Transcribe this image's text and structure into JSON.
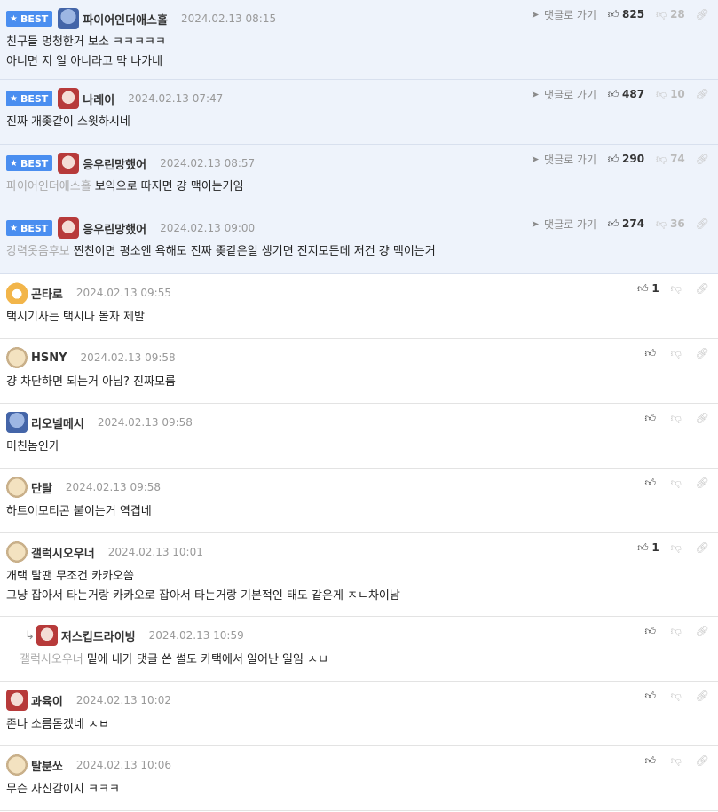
{
  "labels": {
    "best": "BEST",
    "reply_to": "댓글로 가기"
  },
  "colors": {
    "best_bg": "#eef3fb",
    "badge": "#4a8ef0"
  },
  "comments": [
    {
      "best": true,
      "avatar": "blue-character",
      "nick": "파이어인더애스홀",
      "time": "2024.02.13 08:15",
      "mention": "",
      "lines": [
        "친구들 멍청한거 보소 ㅋㅋㅋㅋㅋ",
        "아니면 지 일 아니라고 막 나가네"
      ],
      "up": "825",
      "down": "28"
    },
    {
      "best": true,
      "avatar": "dog-face",
      "nick": "나레이",
      "time": "2024.02.13 07:47",
      "mention": "",
      "lines": [
        "진짜 개좆같이 스윗하시네"
      ],
      "up": "487",
      "down": "10"
    },
    {
      "best": true,
      "avatar": "dog-face",
      "nick": "응우린망했어",
      "time": "2024.02.13 08:57",
      "mention": "파이어인더애스홀",
      "lines": [
        "보익으로 따지면 걍 맥이는거임"
      ],
      "up": "290",
      "down": "74"
    },
    {
      "best": true,
      "avatar": "dog-face",
      "nick": "응우린망했어",
      "time": "2024.02.13 09:00",
      "mention": "강력옷음후보",
      "lines": [
        "찐친이면 평소엔 욕해도 진짜 좆같은일 생기면 진지모든데 저건 걍 맥이는거"
      ],
      "up": "274",
      "down": "36"
    },
    {
      "best": false,
      "avatar": "corgi",
      "nick": "곤타로",
      "time": "2024.02.13 09:55",
      "mention": "",
      "lines": [
        "택시기사는 택시나 몰자 제발"
      ],
      "up": "1",
      "down": ""
    },
    {
      "best": false,
      "avatar": "puppy",
      "nick": "HSNY",
      "time": "2024.02.13 09:58",
      "mention": "",
      "lines": [
        "걍 차단하면 되는거 아님? 진짜모름"
      ],
      "up": "",
      "down": ""
    },
    {
      "best": false,
      "avatar": "blue-character",
      "nick": "리오넬메시",
      "time": "2024.02.13 09:58",
      "mention": "",
      "lines": [
        "미친놈인가"
      ],
      "up": "",
      "down": ""
    },
    {
      "best": false,
      "avatar": "puppy",
      "nick": "단탈",
      "time": "2024.02.13 09:58",
      "mention": "",
      "lines": [
        "하트이모티콘 붙이는거 역겹네"
      ],
      "up": "",
      "down": ""
    },
    {
      "best": false,
      "avatar": "puppy",
      "nick": "갤럭시오우너",
      "time": "2024.02.13 10:01",
      "mention": "",
      "lines": [
        "개택 탈땐 무조건 카카오씀",
        "그냥 잡아서 타는거랑 카카오로 잡아서 타는거랑 기본적인 태도 같은게 ㅈㄴ차이남"
      ],
      "up": "1",
      "down": ""
    },
    {
      "best": false,
      "reply": true,
      "avatar": "dog-face",
      "nick": "저스킵드라이빙",
      "time": "2024.02.13 10:59",
      "mention": "갤럭시오우너",
      "lines": [
        "밑에 내가 댓글 쓴 썰도 카택에서 일어난 일임 ㅅㅂ"
      ],
      "up": "",
      "down": ""
    },
    {
      "best": false,
      "avatar": "dog-face",
      "nick": "과육이",
      "time": "2024.02.13 10:02",
      "mention": "",
      "lines": [
        "존나 소름돋겠네 ㅅㅂ"
      ],
      "up": "",
      "down": ""
    },
    {
      "best": false,
      "avatar": "puppy",
      "nick": "탈분쏘",
      "time": "2024.02.13 10:06",
      "mention": "",
      "lines": [
        "무슨 자신감이지 ㅋㅋㅋ"
      ],
      "up": "",
      "down": ""
    }
  ]
}
